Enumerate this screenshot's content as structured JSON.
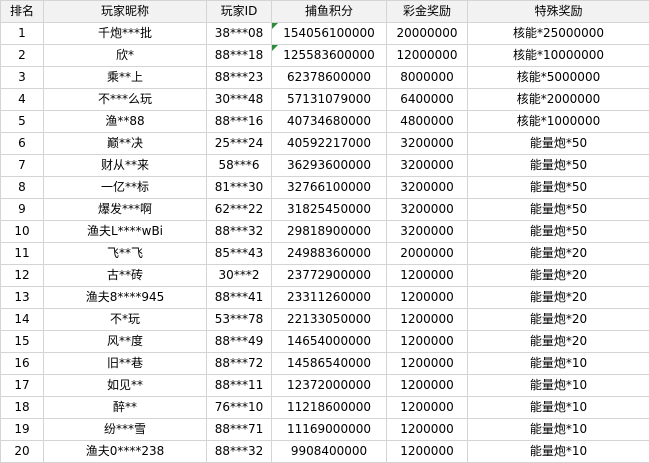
{
  "headers": [
    "排名",
    "玩家昵称",
    "玩家ID",
    "捕鱼积分",
    "彩金奖励",
    "特殊奖励"
  ],
  "rows": [
    {
      "rank": "1",
      "nickname": "千炮***批",
      "player_id": "38***08",
      "score": "154056100000",
      "jackpot": "20000000",
      "special": "核能*25000000",
      "flag": true
    },
    {
      "rank": "2",
      "nickname": "欣*",
      "player_id": "88***18",
      "score": "125583600000",
      "jackpot": "12000000",
      "special": "核能*10000000",
      "flag": true
    },
    {
      "rank": "3",
      "nickname": "乘**上",
      "player_id": "88***23",
      "score": "62378600000",
      "jackpot": "8000000",
      "special": "核能*5000000"
    },
    {
      "rank": "4",
      "nickname": "不***么玩",
      "player_id": "30***48",
      "score": "57131079000",
      "jackpot": "6400000",
      "special": "核能*2000000"
    },
    {
      "rank": "5",
      "nickname": "渔**88",
      "player_id": "88***16",
      "score": "40734680000",
      "jackpot": "4800000",
      "special": "核能*1000000"
    },
    {
      "rank": "6",
      "nickname": "巅**决",
      "player_id": "25***24",
      "score": "40592217000",
      "jackpot": "3200000",
      "special": "能量炮*50"
    },
    {
      "rank": "7",
      "nickname": "财从**来",
      "player_id": "58***6",
      "score": "36293600000",
      "jackpot": "3200000",
      "special": "能量炮*50"
    },
    {
      "rank": "8",
      "nickname": "一亿**标",
      "player_id": "81***30",
      "score": "32766100000",
      "jackpot": "3200000",
      "special": "能量炮*50"
    },
    {
      "rank": "9",
      "nickname": "爆发***啊",
      "player_id": "62***22",
      "score": "31825450000",
      "jackpot": "3200000",
      "special": "能量炮*50"
    },
    {
      "rank": "10",
      "nickname": "渔夫L****wBi",
      "player_id": "88***32",
      "score": "29818900000",
      "jackpot": "3200000",
      "special": "能量炮*50"
    },
    {
      "rank": "11",
      "nickname": "飞**飞",
      "player_id": "85***43",
      "score": "24988360000",
      "jackpot": "2000000",
      "special": "能量炮*20"
    },
    {
      "rank": "12",
      "nickname": "古**砖",
      "player_id": "30***2",
      "score": "23772900000",
      "jackpot": "1200000",
      "special": "能量炮*20"
    },
    {
      "rank": "13",
      "nickname": "渔夫8****945",
      "player_id": "88***41",
      "score": "23311260000",
      "jackpot": "1200000",
      "special": "能量炮*20"
    },
    {
      "rank": "14",
      "nickname": "不*玩",
      "player_id": "53***78",
      "score": "22133050000",
      "jackpot": "1200000",
      "special": "能量炮*20"
    },
    {
      "rank": "15",
      "nickname": "风**度",
      "player_id": "88***49",
      "score": "14654000000",
      "jackpot": "1200000",
      "special": "能量炮*20"
    },
    {
      "rank": "16",
      "nickname": "旧**巷",
      "player_id": "88***72",
      "score": "14586540000",
      "jackpot": "1200000",
      "special": "能量炮*10"
    },
    {
      "rank": "17",
      "nickname": "如见**",
      "player_id": "88***11",
      "score": "12372000000",
      "jackpot": "1200000",
      "special": "能量炮*10"
    },
    {
      "rank": "18",
      "nickname": "醉**",
      "player_id": "76***10",
      "score": "11218600000",
      "jackpot": "1200000",
      "special": "能量炮*10"
    },
    {
      "rank": "19",
      "nickname": "纷***雪",
      "player_id": "88***71",
      "score": "11169000000",
      "jackpot": "1200000",
      "special": "能量炮*10"
    },
    {
      "rank": "20",
      "nickname": "渔夫0****238",
      "player_id": "88***32",
      "score": "9908400000",
      "jackpot": "1200000",
      "special": "能量炮*10"
    }
  ],
  "colors": {
    "grid": "#d4d4d4",
    "header_bg": "#f2f2f2",
    "flag": "#2e8b3a"
  }
}
